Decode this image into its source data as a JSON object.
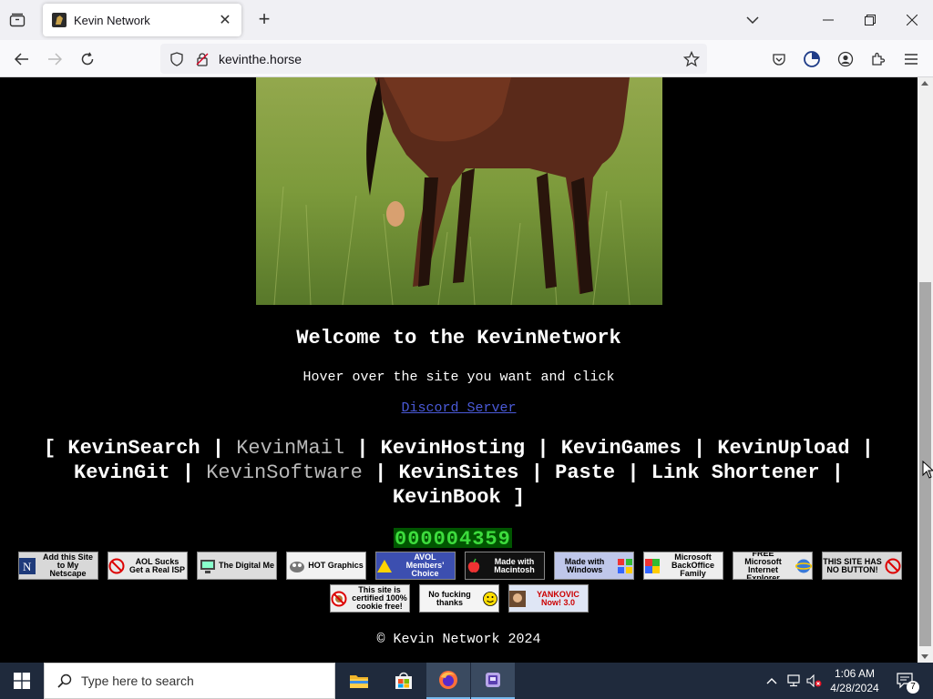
{
  "browser": {
    "tab_title": "Kevin Network",
    "url": "kevinthe.horse"
  },
  "page": {
    "horse_image_alt": "",
    "welcome": "Welcome to the KevinNetwork",
    "hover_text": "Hover over the site you want and click",
    "discord_link": "Discord Server",
    "nav": {
      "open_bracket": "[",
      "close_bracket": "]",
      "separator": "|",
      "links": [
        {
          "label": "KevinSearch",
          "dim": false
        },
        {
          "label": "KevinMail",
          "dim": true
        },
        {
          "label": "KevinHosting",
          "dim": false
        },
        {
          "label": "KevinGames",
          "dim": false
        },
        {
          "label": "KevinUpload",
          "dim": false
        },
        {
          "label": "KevinGit",
          "dim": false
        },
        {
          "label": "KevinSoftware",
          "dim": true
        },
        {
          "label": "KevinSites",
          "dim": false
        },
        {
          "label": "Paste",
          "dim": false
        },
        {
          "label": "Link Shortener",
          "dim": false
        },
        {
          "label": "KevinBook",
          "dim": false
        }
      ]
    },
    "counter": "000004359",
    "badges_row1": [
      {
        "text": "Add this Site to My Netscape"
      },
      {
        "text": "AOL Sucks Get a Real ISP"
      },
      {
        "text": "The Digital Me"
      },
      {
        "text": "HOT Graphics"
      },
      {
        "text": "AVOL Members' Choice"
      },
      {
        "text": "Made with Macintosh"
      },
      {
        "text": "Made with Windows"
      },
      {
        "text": "Microsoft BackOffice Family"
      },
      {
        "text": "FREE Microsoft Internet Explorer"
      },
      {
        "text": "THIS SITE HAS NO BUTTON!"
      }
    ],
    "badges_row2": [
      {
        "text": "This site is certified 100% cookie free!"
      },
      {
        "text": "No fucking thanks"
      },
      {
        "text": "YANKOVIC Now! 3.0"
      }
    ],
    "copyright": "© Kevin Network 2024"
  },
  "taskbar": {
    "search_placeholder": "Type here to search",
    "time": "1:06 AM",
    "date": "4/28/2024",
    "notifications": "7"
  }
}
